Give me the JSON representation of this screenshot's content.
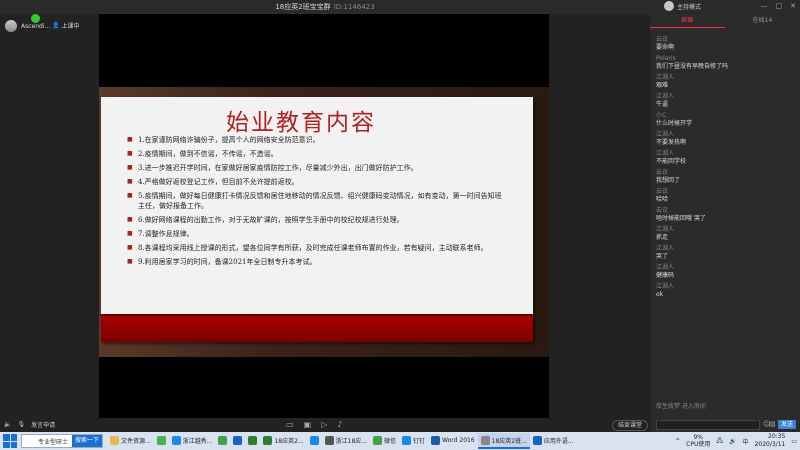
{
  "window": {
    "title": "18应英2班宝宝群",
    "room_id": "ID:1146423",
    "mode_label": "主持模式",
    "controls": [
      "—",
      "□",
      "✕"
    ]
  },
  "presenter": {
    "name": "Ascendi...",
    "status": "上课中"
  },
  "slide": {
    "title": "始业教育内容",
    "items": [
      "1.在家谨防网络诈骗份子，提高个人的网络安全防范意识。",
      "2.疫情期间，做到不信谣，不传谣，不造谣。",
      "3.进一步推迟开学时间，在家做好居家疫情防控工作，尽量减少外出，出门做好防护工作。",
      "4.严格做好返校登记工作，但目前不允许提前返校。",
      "5.疫情期间，做好每日健康打卡情况反馈和居住地移动的情况反馈、绍兴健康码变动情况，如有变动，第一时间告知班主任，做好报备工作。",
      "6.做好网络课程的出勤工作，对于无故旷课的，按照学生手册中的校纪校规进行处理。",
      "7.调整作息规律。",
      "8.各课程均采用线上授课的形式，望各位同学有所获，及时完成任课老师布置的作业，若有疑问，主动联系老师。",
      "9.利用居家学习的时间，备课2021年全日制专升本考试。"
    ]
  },
  "controls": {
    "mic_label": "发言申请",
    "exit_label": "结束课堂"
  },
  "chat": {
    "tabs": [
      "群聊",
      "在线14"
    ],
    "messages": [
      {
        "name": "云议",
        "text": "要命啊"
      },
      {
        "name": "Polaris",
        "text": "我们下昼没有早晚自修了吗"
      },
      {
        "name": "江湖人",
        "text": "艰难"
      },
      {
        "name": "江湖人",
        "text": "牛逼"
      },
      {
        "name": "小C",
        "text": "什么时候开学"
      },
      {
        "name": "江湖人",
        "text": "不要发热啊"
      },
      {
        "name": "江湖人",
        "text": "不能回学校"
      },
      {
        "name": "云议",
        "text": "我想回了"
      },
      {
        "name": "云议",
        "text": "哈哈"
      },
      {
        "name": "云议",
        "text": "啥时候能回哦 哭了"
      },
      {
        "name": "江湖人",
        "text": "抓走"
      },
      {
        "name": "江湖人",
        "text": "哭了"
      },
      {
        "name": "江湖人",
        "text": "健康码"
      },
      {
        "name": "江湖人",
        "text": "ok"
      }
    ],
    "join_notice": "厚生故梦 进入房间",
    "send_label": "发送"
  },
  "taskbar": {
    "search_text": "专业型研士",
    "search_button": "搜索一下",
    "items": [
      {
        "label": "文件资源...",
        "color": "#e8b84a"
      },
      {
        "label": "",
        "color": "#4caf50"
      },
      {
        "label": "浙江越秀...",
        "color": "#1e88e5"
      },
      {
        "label": "",
        "color": "#43a047"
      },
      {
        "label": "",
        "color": "#1565c0"
      },
      {
        "label": "",
        "color": "#2e7d32"
      },
      {
        "label": "18应英2...",
        "color": "#2e7d32"
      },
      {
        "label": "",
        "color": "#1e88e5"
      },
      {
        "label": "浙江18应...",
        "color": "#555"
      },
      {
        "label": "微信",
        "color": "#43a047"
      },
      {
        "label": "钉钉",
        "color": "#1e88e5"
      },
      {
        "label": "Word 2016",
        "color": "#1e5aa8"
      },
      {
        "label": "18应英2班...",
        "color": "#888"
      },
      {
        "label": "应用外语...",
        "color": "#1565c0"
      }
    ],
    "cpu_percent": "9%",
    "cpu_label": "CPU使用",
    "ime": "中",
    "time": "20:35",
    "date": "2020/3/11"
  }
}
